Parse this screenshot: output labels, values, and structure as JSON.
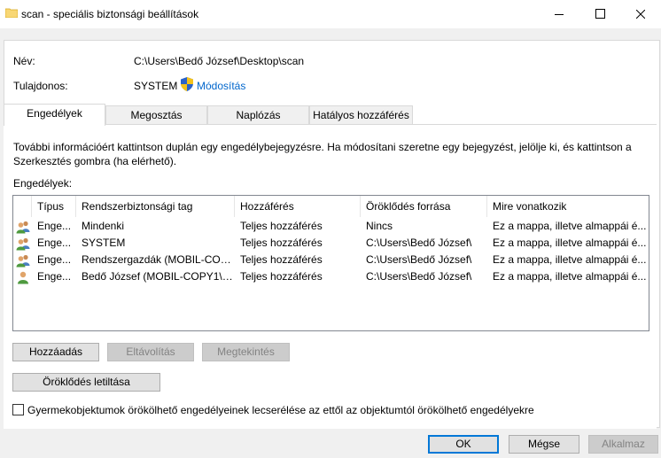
{
  "window": {
    "title": "scan - speciális biztonsági beállítások"
  },
  "info": {
    "name_label": "Név:",
    "name_value": "C:\\Users\\Bedő József\\Desktop\\scan",
    "owner_label": "Tulajdonos:",
    "owner_value": "SYSTEM",
    "change_link": "Módosítás"
  },
  "tabs": [
    {
      "label": "Engedélyek",
      "active": true
    },
    {
      "label": "Megosztás",
      "active": false
    },
    {
      "label": "Naplózás",
      "active": false
    },
    {
      "label": "Hatályos hozzáférés",
      "active": false
    }
  ],
  "permissions": {
    "description": "További információért kattintson duplán egy engedélybejegyzésre. Ha módosítani szeretne egy bejegyzést, jelölje ki, és kattintson a Szerkesztés gombra (ha elérhető).",
    "list_label": "Engedélyek:",
    "columns": [
      "Típus",
      "Rendszerbiztonsági tag",
      "Hozzáférés",
      "Öröklődés forrása",
      "Mire vonatkozik"
    ],
    "rows": [
      {
        "icon": "group-users-icon",
        "type": "Enge...",
        "principal": "Mindenki",
        "access": "Teljes hozzáférés",
        "inherited": "Nincs",
        "applies": "Ez a mappa, illetve almappái é..."
      },
      {
        "icon": "group-users-icon",
        "type": "Enge...",
        "principal": "SYSTEM",
        "access": "Teljes hozzáférés",
        "inherited": "C:\\Users\\Bedő József\\",
        "applies": "Ez a mappa, illetve almappái é..."
      },
      {
        "icon": "group-users-icon",
        "type": "Enge...",
        "principal": "Rendszergazdák (MOBIL-COP...",
        "access": "Teljes hozzáférés",
        "inherited": "C:\\Users\\Bedő József\\",
        "applies": "Ez a mappa, illetve almappái é..."
      },
      {
        "icon": "single-user-icon",
        "type": "Enge...",
        "principal": "Bedő József (MOBIL-COPY1\\B...",
        "access": "Teljes hozzáférés",
        "inherited": "C:\\Users\\Bedő József\\",
        "applies": "Ez a mappa, illetve almappái é..."
      }
    ]
  },
  "buttons": {
    "add": "Hozzáadás",
    "remove": "Eltávolítás",
    "view": "Megtekintés",
    "disable_inheritance": "Öröklődés letiltása"
  },
  "replace_checkbox": {
    "label": "Gyermekobjektumok örökölhető engedélyeinek lecserélése az ettől az objektumtól örökölhető engedélyekre",
    "checked": false
  },
  "footer": {
    "ok": "OK",
    "cancel": "Mégse",
    "apply": "Alkalmaz"
  }
}
